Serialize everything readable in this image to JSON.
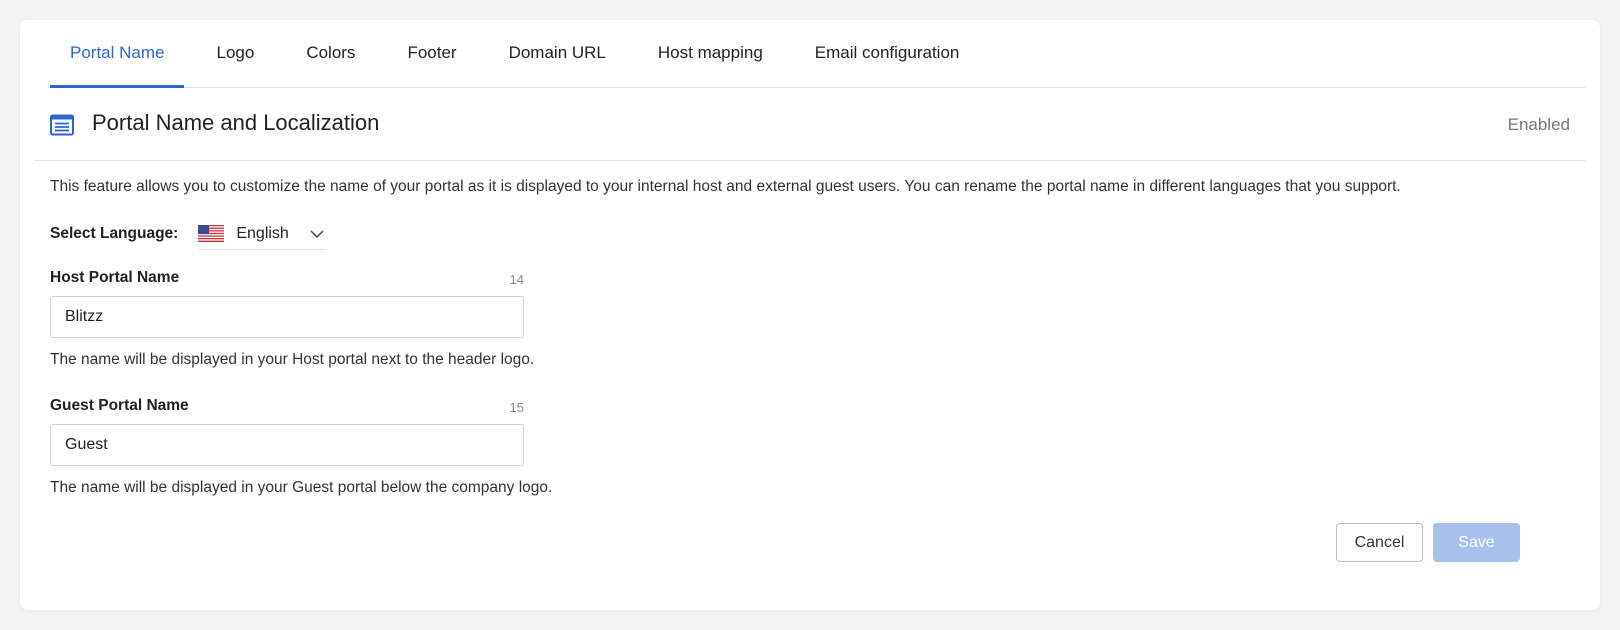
{
  "tabs": [
    {
      "label": "Portal Name",
      "active": true
    },
    {
      "label": "Logo"
    },
    {
      "label": "Colors"
    },
    {
      "label": "Footer"
    },
    {
      "label": "Domain URL"
    },
    {
      "label": "Host mapping"
    },
    {
      "label": "Email configuration"
    }
  ],
  "section": {
    "icon": "browser-window-icon",
    "title": "Portal Name and Localization",
    "status": "Enabled"
  },
  "description": "This feature allows you to customize the name of your portal as it is displayed to your internal host and external guest users. You can rename the portal name in different languages that you support.",
  "language": {
    "label": "Select Language:",
    "selected": "English",
    "flag_icon": "us-flag-icon"
  },
  "host_portal": {
    "label": "Host Portal Name",
    "counter": "14",
    "value": "Blitzz",
    "help": "The name will be displayed in your Host portal next to the header logo."
  },
  "guest_portal": {
    "label": "Guest Portal Name",
    "counter": "15",
    "value": "Guest",
    "help": "The name will be displayed in your Guest portal below the company logo."
  },
  "actions": {
    "cancel_label": "Cancel",
    "save_label": "Save"
  },
  "colors": {
    "accent": "#2b67d1",
    "save_disabled": "#a7c0ec"
  }
}
